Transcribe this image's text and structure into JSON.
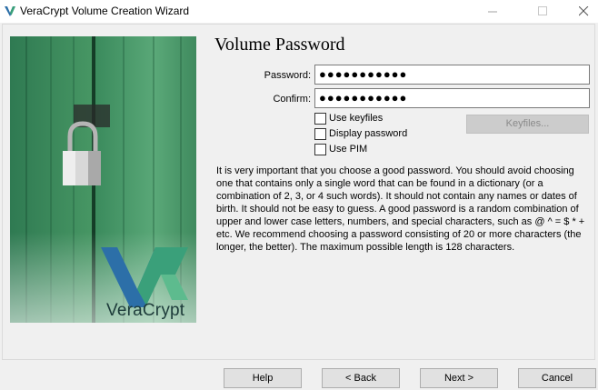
{
  "window": {
    "title": "VeraCrypt Volume Creation Wizard"
  },
  "branding": {
    "name": "VeraCrypt"
  },
  "page": {
    "heading": "Volume Password"
  },
  "form": {
    "password_label": "Password:",
    "password_value": "●●●●●●●●●●●",
    "confirm_label": "Confirm:",
    "confirm_value": "●●●●●●●●●●●"
  },
  "options": {
    "use_keyfiles": {
      "label": "Use keyfiles",
      "checked": false
    },
    "display_password": {
      "label": "Display password",
      "checked": false
    },
    "use_pim": {
      "label": "Use PIM",
      "checked": false
    }
  },
  "keyfiles_button": {
    "label": "Keyfiles...",
    "enabled": false
  },
  "info": {
    "text": "It is very important that you choose a good password. You should avoid choosing one that contains only a single word that can be found in a dictionary (or a combination of 2, 3, or 4 such words). It should not contain any names or dates of birth. It should not be easy to guess. A good password is a random combination of upper and lower case letters, numbers, and special characters, such as @ ^ = $ * + etc. We recommend choosing a password consisting of 20 or more characters (the longer, the better). The maximum possible length is 128 characters."
  },
  "buttons": {
    "help": "Help",
    "back": "< Back",
    "next": "Next >",
    "cancel": "Cancel"
  },
  "colors": {
    "brand_green": "#2f8f6a",
    "brand_blue": "#2c6fa8",
    "door_green": "#3f8a5e"
  },
  "icons": {
    "app": "veracrypt-logo-icon",
    "minimize": "minimize-icon",
    "maximize": "maximize-icon",
    "close": "close-icon",
    "lock": "padlock-icon"
  }
}
